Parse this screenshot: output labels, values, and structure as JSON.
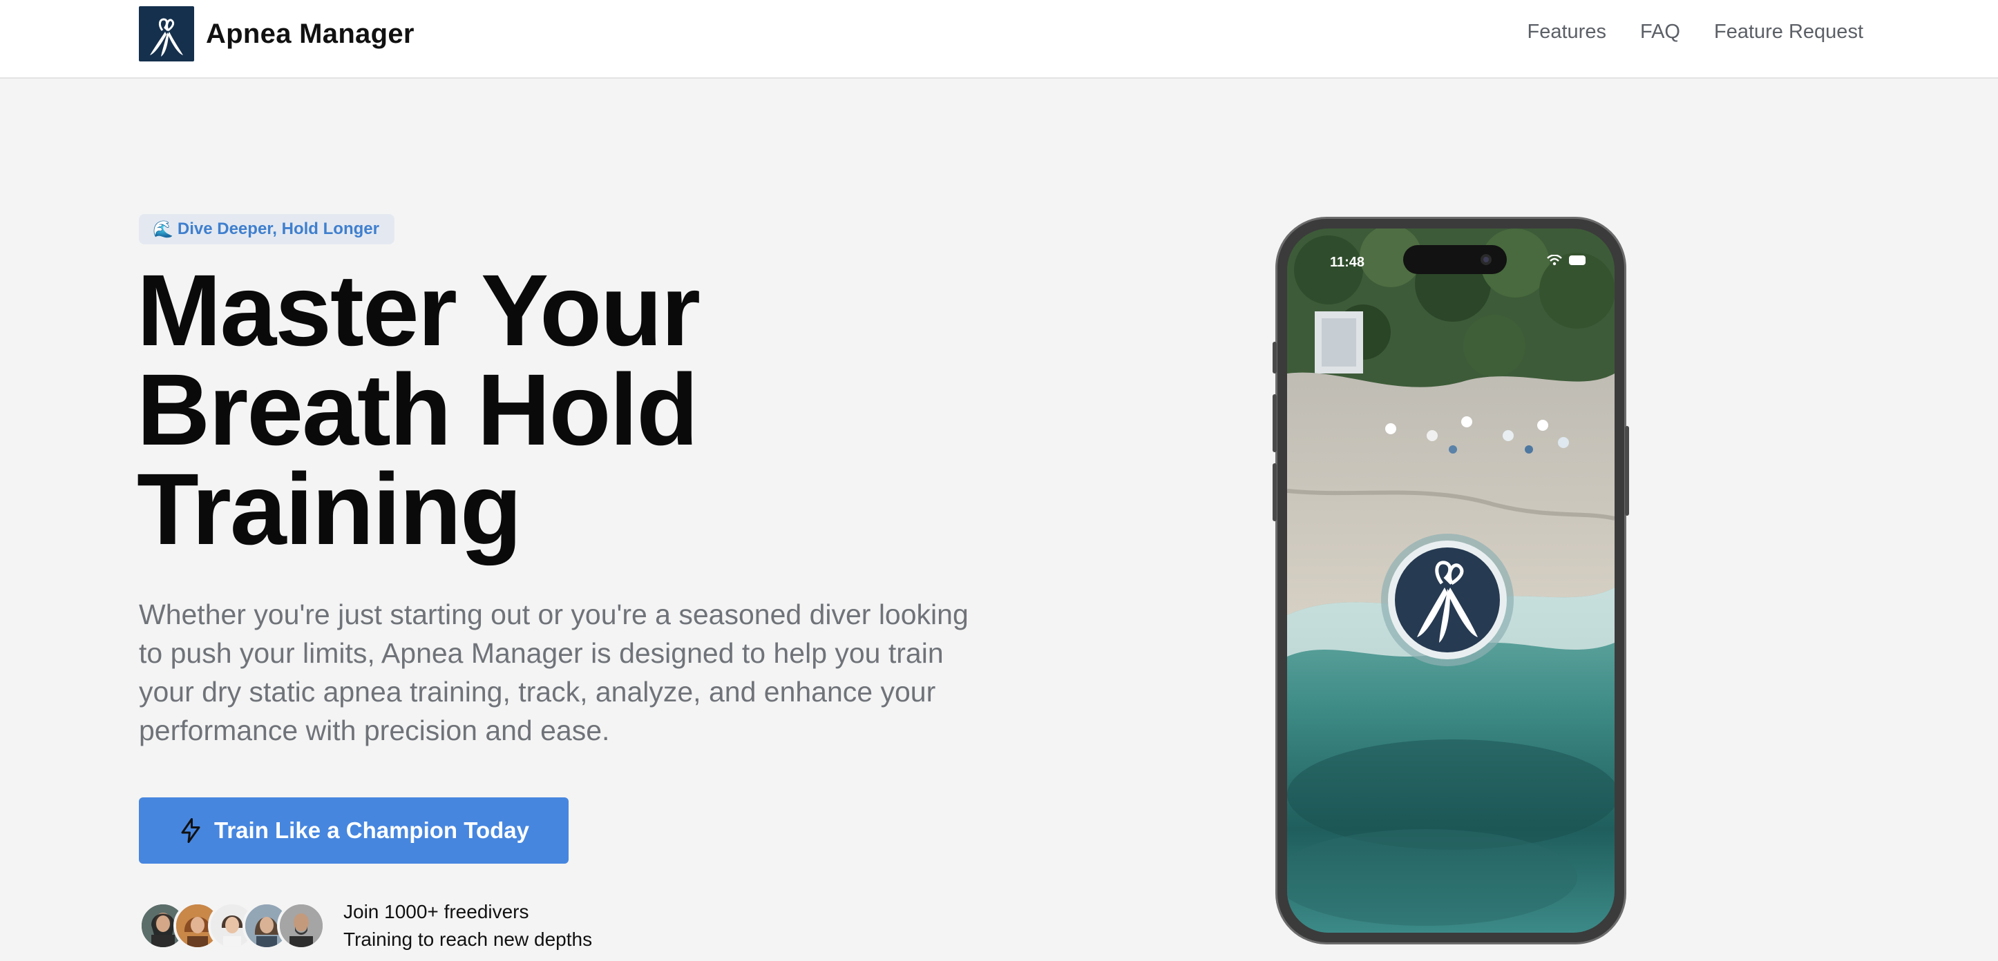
{
  "header": {
    "brand_name": "Apnea Manager",
    "logo_icon": "apnea-fins-logo",
    "nav": [
      {
        "label": "Features"
      },
      {
        "label": "FAQ"
      },
      {
        "label": "Feature Request"
      }
    ]
  },
  "hero": {
    "badge": {
      "icon": "🌊",
      "label": "Dive Deeper, Hold Longer"
    },
    "headline": {
      "line1": "Master Your",
      "line2": "Breath Hold",
      "line3": "Training"
    },
    "subtext": "Whether you're just starting out or you're a seasoned diver looking to push your limits, Apnea Manager is designed to help you train your dry static apnea training, track, analyze, and enhance your performance with precision and ease.",
    "cta": {
      "label": "Train Like a Champion Today",
      "icon": "lightning-icon"
    },
    "social_proof": {
      "line1": "Join 1000+ freedivers",
      "line2": "Training to reach new depths",
      "avatar_count": 5
    }
  },
  "phone": {
    "status_time": "11:48",
    "status_icons": [
      "wifi-icon",
      "battery-icon"
    ]
  },
  "colors": {
    "accent": "#4686df",
    "badge_text": "#3f7fce",
    "logo_bg": "#14304d"
  }
}
